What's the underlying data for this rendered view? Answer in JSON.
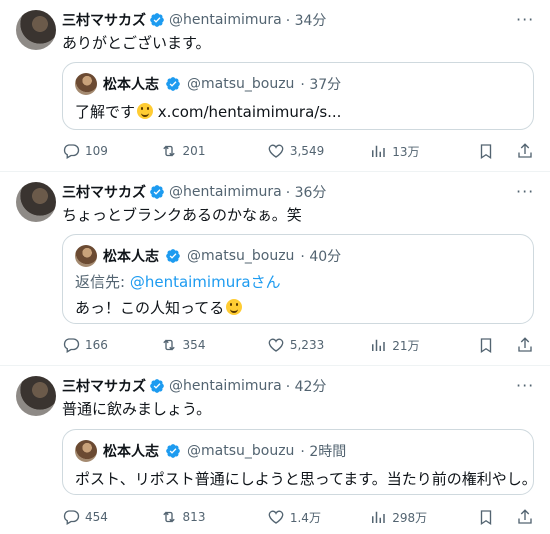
{
  "colors": {
    "accent": "#1d9bf0",
    "secondary_text": "#536471",
    "border": "#cfd9de"
  },
  "tweets": [
    {
      "author": {
        "name": "三村マサカズ",
        "handle": "@hentaimimura",
        "time": "· 34分"
      },
      "text": "ありがとございます。",
      "quote": {
        "author": {
          "name": "松本人志",
          "handle": "@matsu_bouzu",
          "time": "· 37分"
        },
        "text": "了解です",
        "link": "x.com/hentaimimura/s..."
      },
      "stats": {
        "replies": "109",
        "reposts": "201",
        "likes": "3,549",
        "views": "13万"
      }
    },
    {
      "author": {
        "name": "三村マサカズ",
        "handle": "@hentaimimura",
        "time": "· 36分"
      },
      "text": "ちょっとブランクあるのかなぁ。笑",
      "quote": {
        "author": {
          "name": "松本人志",
          "handle": "@matsu_bouzu",
          "time": "· 40分"
        },
        "reply_prefix": "返信先: ",
        "reply_to": "@hentaimimuraさん",
        "text": "あっ！この人知ってる"
      },
      "stats": {
        "replies": "166",
        "reposts": "354",
        "likes": "5,233",
        "views": "21万"
      }
    },
    {
      "author": {
        "name": "三村マサカズ",
        "handle": "@hentaimimura",
        "time": "· 42分"
      },
      "text": "普通に飲みましょう。",
      "quote": {
        "author": {
          "name": "松本人志",
          "handle": "@matsu_bouzu",
          "time": "· 2時間"
        },
        "text": "ポスト、リポスト普通にしようと思ってます。当たり前の権利やし。"
      },
      "stats": {
        "replies": "454",
        "reposts": "813",
        "likes": "1.4万",
        "views": "298万"
      }
    }
  ]
}
